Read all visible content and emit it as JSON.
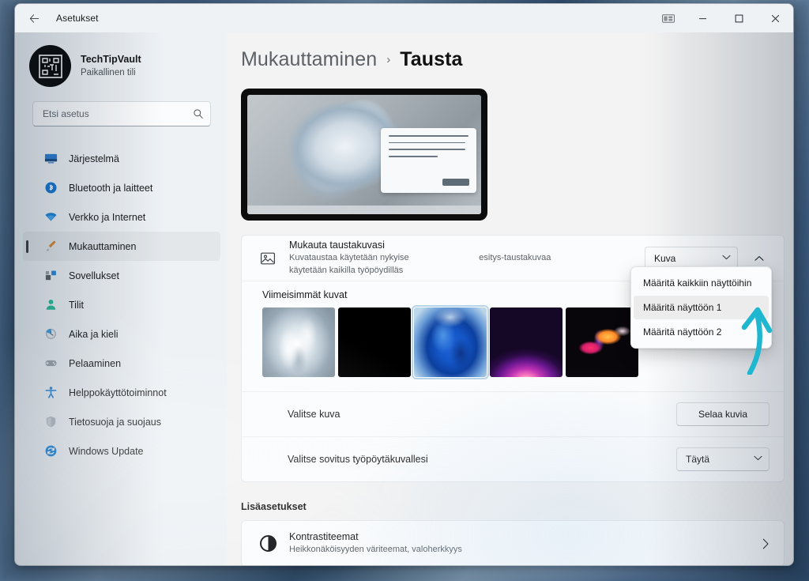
{
  "window": {
    "title": "Asetukset",
    "back_icon": "back-arrow-icon",
    "controls": {
      "snap_layouts": "snap-layouts-icon",
      "minimize": "minimize-icon",
      "maximize": "maximize-icon",
      "close": "close-icon"
    }
  },
  "sidebar": {
    "account": {
      "name": "TechTipVault",
      "subtitle": "Paikallinen tili",
      "avatar_icon": "avatar-maze-icon"
    },
    "search": {
      "placeholder": "Etsi asetus",
      "value": "",
      "icon": "search-icon"
    },
    "items": [
      {
        "label": "Järjestelmä",
        "icon": "system-icon",
        "active": false
      },
      {
        "label": "Bluetooth ja laitteet",
        "icon": "bluetooth-icon",
        "active": false
      },
      {
        "label": "Verkko ja Internet",
        "icon": "network-wifi-icon",
        "active": false
      },
      {
        "label": "Mukauttaminen",
        "icon": "personalization-brush-icon",
        "active": true
      },
      {
        "label": "Sovellukset",
        "icon": "apps-icon",
        "active": false
      },
      {
        "label": "Tilit",
        "icon": "accounts-person-icon",
        "active": false
      },
      {
        "label": "Aika ja kieli",
        "icon": "time-language-clock-icon",
        "active": false
      },
      {
        "label": "Pelaaminen",
        "icon": "gaming-controller-icon",
        "active": false
      },
      {
        "label": "Helppokäyttötoiminnot",
        "icon": "accessibility-icon",
        "active": false
      },
      {
        "label": "Tietosuoja ja suojaus",
        "icon": "privacy-shield-icon",
        "active": false
      },
      {
        "label": "Windows Update",
        "icon": "windows-update-icon",
        "active": false
      }
    ]
  },
  "breadcrumb": {
    "parent": "Mukauttaminen",
    "separator": "›",
    "current": "Tausta"
  },
  "preview": {
    "name": "desktop-background-preview"
  },
  "background_card": {
    "personalize_row": {
      "icon": "picture-icon",
      "title": "Mukauta taustakuvasi",
      "subtitle_line1": "Kuvataustaa käytetään nykyise",
      "subtitle_line1_tail": "esitys-taustakuvaa",
      "subtitle_line2": "käytetään kaikilla työpöydilläs",
      "combo_value": "Kuva",
      "combo_chevron": "chevron-down-icon",
      "expand_chevron": "chevron-up-icon"
    },
    "recent": {
      "label": "Viimeisimmät kuvat",
      "thumbnails": [
        {
          "name": "wallpaper-bloom-light",
          "selected": false
        },
        {
          "name": "wallpaper-black",
          "selected": false
        },
        {
          "name": "wallpaper-bloom-blue",
          "selected": true
        },
        {
          "name": "wallpaper-purple-glow",
          "selected": false
        },
        {
          "name": "wallpaper-abstract-flower",
          "selected": false
        }
      ]
    },
    "choose_image_row": {
      "title": "Valitse kuva",
      "button_label": "Selaa kuvia"
    },
    "fit_row": {
      "title": "Valitse sovitus työpöytäkuvallesi",
      "combo_value": "Täytä",
      "combo_chevron": "chevron-down-icon"
    }
  },
  "flyout": {
    "items": [
      {
        "label": "Määritä kaikkiin näyttöihin",
        "highlighted": false
      },
      {
        "label": "Määritä näyttöön 1",
        "highlighted": true
      },
      {
        "label": "Määritä näyttöön 2",
        "highlighted": false
      }
    ]
  },
  "annotation": {
    "arrow_color": "#1fb6cf",
    "name": "annotation-arrow-to-monitor-1"
  },
  "advanced": {
    "section_title": "Lisäasetukset",
    "contrast_row": {
      "icon": "contrast-themes-icon",
      "title": "Kontrastiteemat",
      "subtitle": "Heikkonäköisyyden väriteemat, valoherkkyys",
      "chevron": "chevron-right-icon"
    }
  },
  "colors": {
    "accent": "#0067c0",
    "window_bg": "#f3f3f3",
    "sidebar_bg": "#eef2f5",
    "card_bg": "#fbfcfd",
    "annotation_teal": "#1fb6cf"
  }
}
